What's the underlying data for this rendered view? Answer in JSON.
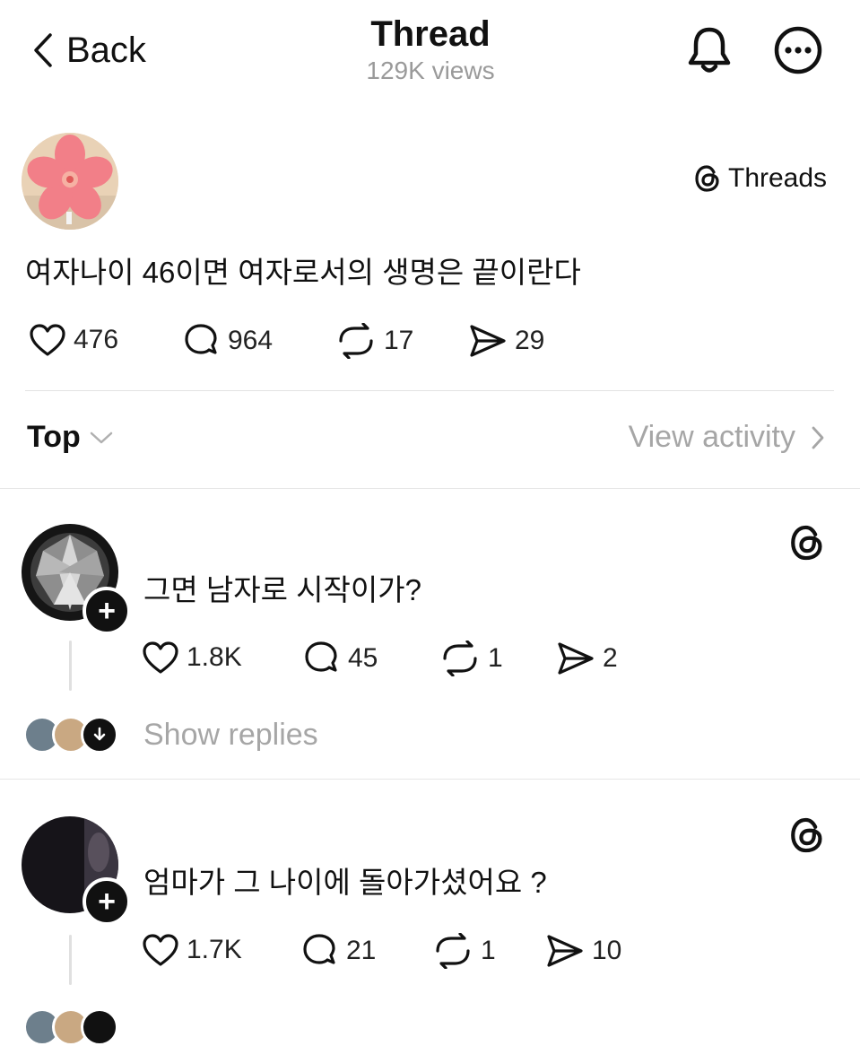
{
  "header": {
    "back_label": "Back",
    "title": "Thread",
    "views": "129K views"
  },
  "post": {
    "source_label": "Threads",
    "text": "여자나이 46이면 여자로서의 생명은 끝이란다",
    "likes": "476",
    "comments": "964",
    "reposts": "17",
    "shares": "29"
  },
  "sort": {
    "label": "Top",
    "view_activity": "View activity"
  },
  "replies": [
    {
      "text": "그면 남자로 시작이가?",
      "likes": "1.8K",
      "comments": "45",
      "reposts": "1",
      "shares": "2",
      "show_replies": "Show replies"
    },
    {
      "text": "엄마가 그 나이에 돌아가셨어요 ?",
      "likes": "1.7K",
      "comments": "21",
      "reposts": "1",
      "shares": "10"
    }
  ],
  "icons": {
    "back": "chevron-left-icon",
    "bell": "bell-icon",
    "more": "ellipsis-circle-icon",
    "threads": "threads-logo-icon",
    "like": "heart-icon",
    "comment": "comment-bubble-icon",
    "repost": "repost-icon",
    "share": "send-icon"
  },
  "colors": {
    "text": "#111111",
    "muted": "#9a9a9a",
    "divider": "#e2e2e2"
  }
}
